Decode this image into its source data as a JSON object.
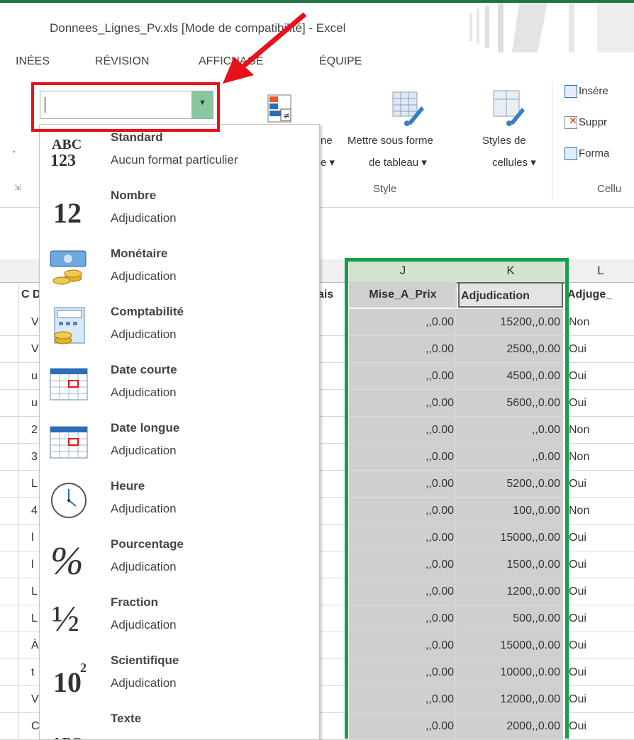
{
  "window": {
    "title": "Donnees_Lignes_Pv.xls  [Mode de compatibilité] - Excel",
    "accent_color": "#217346"
  },
  "ribbon_tabs": [
    "INÉES",
    "RÉVISION",
    "AFFICHAGE",
    "ÉQUIPE"
  ],
  "ribbon": {
    "number_format_value": "",
    "cond_format_label_fragment_1": "ne",
    "cond_format_label_fragment_2": "e ▾",
    "table_format_label_1": "Mettre sous forme",
    "table_format_label_2": "de tableau ▾",
    "cell_styles_label_1": "Styles de",
    "cell_styles_label_2": "cellules ▾",
    "style_group_label": "Style",
    "cells_group_label": "Cellu",
    "insert_label": "Insére",
    "delete_label": "Suppr",
    "format_label": "Forma"
  },
  "number_format_menu": [
    {
      "name": "Standard",
      "sample": "Aucun format particulier",
      "icon": "abc-123-icon"
    },
    {
      "name": "Nombre",
      "sample": "Adjudication",
      "icon": "number-12-icon"
    },
    {
      "name": "Monétaire",
      "sample": "Adjudication",
      "icon": "currency-icon"
    },
    {
      "name": "Comptabilité",
      "sample": "Adjudication",
      "icon": "accounting-icon"
    },
    {
      "name": "Date courte",
      "sample": "Adjudication",
      "icon": "calendar-icon"
    },
    {
      "name": "Date longue",
      "sample": "Adjudication",
      "icon": "calendar-icon"
    },
    {
      "name": "Heure",
      "sample": "Adjudication",
      "icon": "clock-icon"
    },
    {
      "name": "Pourcentage",
      "sample": "Adjudication",
      "icon": "percent-icon"
    },
    {
      "name": "Fraction",
      "sample": "Adjudication",
      "icon": "fraction-icon"
    },
    {
      "name": "Scientifique",
      "sample": "Adjudication",
      "icon": "scientific-icon"
    },
    {
      "name": "Texte",
      "sample": "",
      "icon": "text-abc-icon"
    }
  ],
  "icon_glyphs": {
    "abc_top": "ABC",
    "abc_bottom": "123",
    "twelve": "12",
    "percent": "%",
    "fraction": "½",
    "scientific_base": "10",
    "scientific_exp": "2",
    "text_icon": "ABC"
  },
  "sheet": {
    "columns": [
      "J",
      "K",
      "L"
    ],
    "left_header_fragment": "C D",
    "mid_header_fragment": "ais",
    "headers": [
      "Mise_A_Prix",
      "Adjudication",
      "Adjuge_"
    ],
    "row_first_chars": [
      "V",
      "V",
      "u",
      "u",
      "2",
      "3",
      "L",
      "4",
      "l",
      "l",
      "L",
      "L",
      "À",
      "t",
      "V",
      "C"
    ],
    "mise_a_prix": [
      ",,0.00",
      ",,0.00",
      ",,0.00",
      ",,0.00",
      ",,0.00",
      ",,0.00",
      ",,0.00",
      ",,0.00",
      ",,0.00",
      ",,0.00",
      ",,0.00",
      ",,0.00",
      ",,0.00",
      ",,0.00",
      ",,0.00",
      ",,0.00"
    ],
    "adjudication": [
      "15200,,0.00",
      "2500,,0.00",
      "4500,,0.00",
      "5600,,0.00",
      ",,0.00",
      ",,0.00",
      "5200,,0.00",
      "100,,0.00",
      "15000,,0.00",
      "1500,,0.00",
      "1200,,0.00",
      "500,,0.00",
      "15000,,0.00",
      "10000,,0.00",
      "12000,,0.00",
      "2000,,0.00"
    ],
    "adjuge": [
      "Non",
      "Oui",
      "Oui",
      "Oui",
      "Non",
      "Non",
      "Oui",
      "Non",
      "Oui",
      "Oui",
      "Oui",
      "Oui",
      "Oui",
      "Oui",
      "Oui",
      "Oui"
    ]
  },
  "annotations": {
    "red_color": "#e8101a",
    "green_color": "#12a04a"
  }
}
